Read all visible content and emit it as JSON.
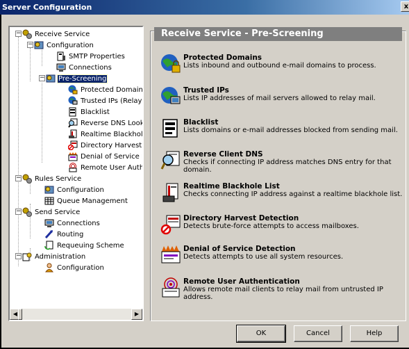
{
  "window": {
    "title": "Server Configuration",
    "close_glyph": "x"
  },
  "tree": {
    "receive_service": "Receive Service",
    "configuration": "Configuration",
    "smtp_properties": "SMTP Properties",
    "connections": "Connections",
    "pre_screening": "Pre-Screening",
    "protected_domains": "Protected Domains",
    "trusted_ips": "Trusted IPs (Relay Sou",
    "blacklist": "Blacklist",
    "reverse_dns": "Reverse DNS Lookup",
    "realtime_blackhole": "Realtime Blackhole List",
    "directory_harvest": "Directory Harvest Dete",
    "denial_of_service": "Denial of Service Dete",
    "remote_user_auth": "Remote User Authenti",
    "rules_service": "Rules Service",
    "rules_configuration": "Configuration",
    "queue_management": "Queue Management",
    "send_service": "Send Service",
    "send_connections": "Connections",
    "routing": "Routing",
    "requeuing_scheme": "Requeuing Scheme",
    "administration": "Administration",
    "admin_configuration": "Configuration",
    "expander_minus": "−"
  },
  "scrollbar": {
    "left": "◀",
    "right": "▶"
  },
  "panel": {
    "header": "Receive Service - Pre-Screening",
    "items": [
      {
        "title": "Protected Domains",
        "desc": "Lists inbound and outbound e-mail domains to process.",
        "icon": "globe-lock-icon"
      },
      {
        "title": "Trusted IPs",
        "desc": "Lists IP addresses of mail servers allowed to relay mail.",
        "icon": "globe-computer-icon"
      },
      {
        "title": "Blacklist",
        "desc": "Lists domains or e-mail addresses blocked from sending mail.",
        "icon": "blacklist-document-icon"
      },
      {
        "title": "Reverse Client DNS",
        "desc": "Checks if connecting IP address matches DNS entry for that domain.",
        "icon": "magnifier-icon"
      },
      {
        "title": "Realtime Blackhole List",
        "desc": "Checks connecting IP address against a realtime blackhole list.",
        "icon": "blackhole-list-icon"
      },
      {
        "title": "Directory Harvest Detection",
        "desc": "Detects brute-force attempts to access mailboxes.",
        "icon": "harvest-detection-icon"
      },
      {
        "title": "Denial of Service Detection",
        "desc": "Detects attempts to use all system resources.",
        "icon": "denial-of-service-icon"
      },
      {
        "title": "Remote User Authentication",
        "desc": "Allows remote mail clients to relay mail from untrusted IP address.",
        "icon": "remote-auth-icon"
      }
    ]
  },
  "buttons": {
    "ok": "OK",
    "cancel": "Cancel",
    "help": "Help"
  },
  "colors": {
    "title_bar": "#0a246a",
    "selection": "#0a246a",
    "header_bar": "#7f7f7f",
    "face": "#d4d0c8"
  }
}
